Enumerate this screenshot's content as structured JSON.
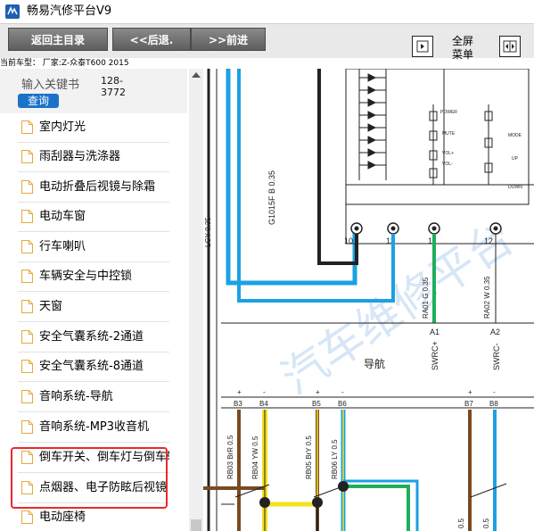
{
  "window": {
    "title": "畅易汽修平台V9"
  },
  "toolbar": {
    "back_main": "返回主目录",
    "back": "<<后退.",
    "forward": ">>前进",
    "fullscreen_line1": "全屏",
    "fullscreen_line2": "菜单"
  },
  "car_model": "当前车型： 厂家:Z-众泰T600 2015",
  "search": {
    "placeholder": "输入关键书",
    "value_line1": "128-",
    "value_line2": "3772",
    "button": "查询"
  },
  "sidebar": {
    "items": [
      {
        "label": "室内灯光"
      },
      {
        "label": "雨刮器与洗涤器"
      },
      {
        "label": "电动折叠后视镜与除霜"
      },
      {
        "label": "电动车窗"
      },
      {
        "label": "行车喇叭"
      },
      {
        "label": "车辆安全与中控锁"
      },
      {
        "label": "天窗"
      },
      {
        "label": "安全气囊系统-2通道"
      },
      {
        "label": "安全气囊系统-8通道"
      },
      {
        "label": "音响系统-导航"
      },
      {
        "label": "音响系统-MP3收音机"
      },
      {
        "label": "倒车开关、倒车灯与倒车辅助"
      },
      {
        "label": "点烟器、电子防眩后视镜"
      },
      {
        "label": "电动座椅"
      }
    ]
  },
  "diagram": {
    "watermark": "汽车维修平台",
    "connector_pins": [
      "10",
      "13",
      "11",
      "12"
    ],
    "wire_labels_top": [
      "G1015F B 0.35",
      "RA01 G 0.35",
      "RA02 W 0.35"
    ],
    "pins_mid": [
      "A1",
      "A2"
    ],
    "signals": [
      "SWRC+",
      "SWRC-"
    ],
    "section_label": "导航",
    "switch_labels": [
      "POWER",
      "MUTE",
      "VOL-",
      "VOL+",
      "MODE",
      "UP",
      "DOWN"
    ],
    "bottom_pins": [
      "B3",
      "B4",
      "B5",
      "B6",
      "B7",
      "B8"
    ],
    "bottom_signs": [
      "+",
      "-",
      "+",
      "-",
      "+",
      "-"
    ],
    "bottom_wires": [
      "RB03 BrR 0.5",
      "RB04 YW 0.5",
      "RB05 BrY 0.5",
      "RB06 LY 0.5"
    ],
    "edge_texts": [
      "LGY 0.35",
      "0.5",
      "0.5"
    ]
  },
  "colors": {
    "highlight": "#e8282d",
    "query_button": "#1a73c8",
    "wire_blue": "#1ba1e2",
    "wire_green": "#1fae5a",
    "wire_brown": "#7a4a22",
    "wire_yellow": "#f4e21c"
  }
}
